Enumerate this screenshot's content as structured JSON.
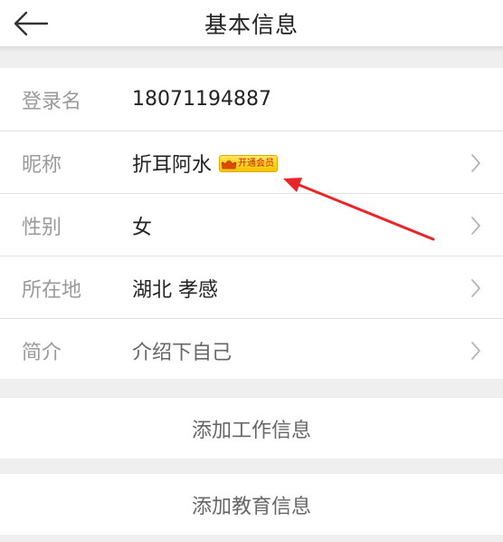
{
  "header": {
    "title": "基本信息"
  },
  "fields": [
    {
      "label": "登录名",
      "value": "18071194887"
    },
    {
      "label": "昵称",
      "value": "折耳阿水",
      "badge": "开通会员"
    },
    {
      "label": "性别",
      "value": "女"
    },
    {
      "label": "所在地",
      "value": "湖北 孝感"
    },
    {
      "label": "简介",
      "value": "介绍下自己"
    }
  ],
  "actions": {
    "add_work": "添加工作信息",
    "add_education": "添加教育信息"
  },
  "colors": {
    "annotation_arrow": "#e8262a",
    "badge_bg": "#f9d43a",
    "badge_text": "#d11a00"
  }
}
